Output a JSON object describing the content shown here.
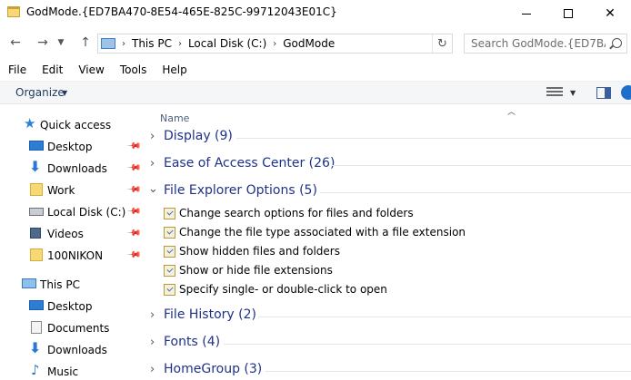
{
  "window": {
    "title": "GodMode.{ED7BA470-8E54-465E-825C-99712043E01C}",
    "icon": "folder-icon",
    "controls": [
      "minimize",
      "maximize",
      "close"
    ]
  },
  "address_bar": {
    "breadcrumbs": [
      "This PC",
      "Local Disk (C:)",
      "GodMode"
    ],
    "search_placeholder": "Search GodMode.{ED7BA4..."
  },
  "menu": [
    "File",
    "Edit",
    "View",
    "Tools",
    "Help"
  ],
  "toolbar": {
    "organize_label": "Organize"
  },
  "navigation": {
    "quick_access_label": "Quick access",
    "quick_access_items": [
      {
        "label": "Desktop",
        "icon": "desktop-icon",
        "pinned": true
      },
      {
        "label": "Downloads",
        "icon": "download-icon",
        "pinned": true
      },
      {
        "label": "Work",
        "icon": "folder-icon",
        "pinned": true
      },
      {
        "label": "Local Disk (C:)",
        "icon": "disk-icon",
        "pinned": true
      },
      {
        "label": "Videos",
        "icon": "video-icon",
        "pinned": true
      },
      {
        "label": "100NIKON",
        "icon": "folder-icon",
        "pinned": true
      }
    ],
    "this_pc_label": "This PC",
    "this_pc_items": [
      {
        "label": "Desktop",
        "icon": "desktop-icon"
      },
      {
        "label": "Documents",
        "icon": "document-icon"
      },
      {
        "label": "Downloads",
        "icon": "download-icon"
      },
      {
        "label": "Music",
        "icon": "music-icon"
      }
    ]
  },
  "content": {
    "column_header": "Name",
    "groups": [
      {
        "title": "Display (9)",
        "expanded": false
      },
      {
        "title": "Ease of Access Center (26)",
        "expanded": false
      },
      {
        "title": "File Explorer Options (5)",
        "expanded": true,
        "items": [
          "Change search options for files and folders",
          "Change the file type associated with a file extension",
          "Show hidden files and folders",
          "Show or hide file extensions",
          "Specify single- or double-click to open"
        ]
      },
      {
        "title": "File History (2)",
        "expanded": false
      },
      {
        "title": "Fonts (4)",
        "expanded": false
      },
      {
        "title": "HomeGroup (3)",
        "expanded": false
      }
    ]
  }
}
